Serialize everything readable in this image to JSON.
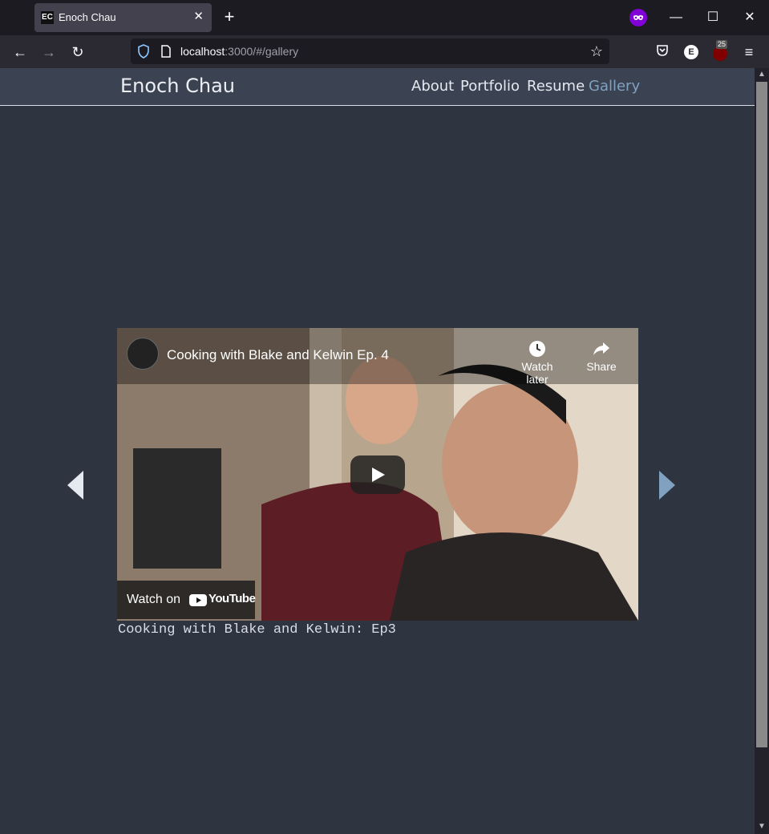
{
  "browser": {
    "tab_title": "Enoch Chau",
    "tab_favicon_text": "EC",
    "url_host": "localhost",
    "url_rest": ":3000/#/gallery",
    "extension_badge": "25",
    "extension_letter": "E"
  },
  "site": {
    "name": "Enoch Chau",
    "nav": [
      {
        "label": "About",
        "active": false
      },
      {
        "label": "Portfolio",
        "active": false
      },
      {
        "label": "Resume",
        "active": false
      },
      {
        "label": "Gallery",
        "active": true
      }
    ]
  },
  "gallery": {
    "video": {
      "title": "Cooking with Blake and Kelwin Ep. 4",
      "watch_later_label": "Watch later",
      "share_label": "Share",
      "watch_on_label": "Watch on",
      "youtube_label": "YouTube"
    },
    "caption": "Cooking with Blake and Kelwin: Ep3"
  },
  "colors": {
    "background": "#2e3440",
    "header": "#3b4252",
    "active_link": "#81a1c1",
    "left_arrow": "#e5e9f0",
    "right_arrow": "#81a1c1"
  }
}
